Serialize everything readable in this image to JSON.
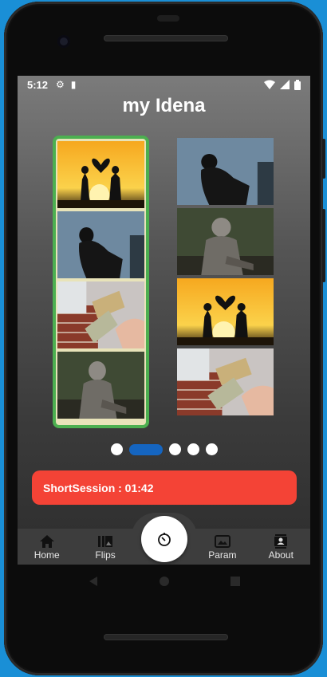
{
  "statusbar": {
    "time": "5:12",
    "settings_icon": "gear-icon",
    "sd_icon": "sd-card-icon",
    "wifi_icon": "wifi-icon",
    "signal_icon": "signal-icon",
    "battery_icon": "battery-icon"
  },
  "app": {
    "title": "my Idena"
  },
  "flips": {
    "left": {
      "selected": true,
      "frames": [
        "couple-heart-sunset",
        "man-head-in-hands",
        "hands-exchanging-cash",
        "hooded-man-sitting"
      ]
    },
    "right": {
      "selected": false,
      "frames": [
        "man-head-in-hands",
        "hooded-man-sitting",
        "couple-heart-sunset",
        "hands-exchanging-cash"
      ]
    }
  },
  "pager": {
    "count": 5,
    "active_index": 1
  },
  "session": {
    "label": "ShortSession : 01:42",
    "color": "#f44336"
  },
  "bottom_nav": {
    "items": [
      {
        "label": "Home",
        "icon": "home-icon"
      },
      {
        "label": "Flips",
        "icon": "gallery-icon"
      },
      {
        "label": "Param",
        "icon": "photo-icon"
      },
      {
        "label": "About",
        "icon": "contact-icon"
      }
    ],
    "fab_icon": "timer-icon"
  },
  "system_nav": {
    "back_icon": "back-icon",
    "home_icon": "home-circle-icon",
    "recents_icon": "recents-icon"
  },
  "colors": {
    "accent": "#1565c0",
    "selected_border": "#4caf50",
    "danger": "#f44336"
  }
}
